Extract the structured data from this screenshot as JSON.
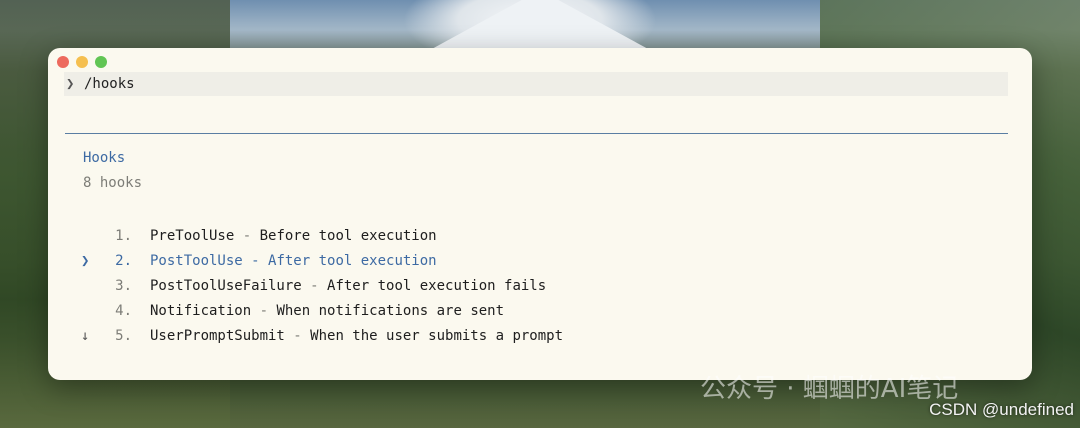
{
  "terminal": {
    "prompt_symbol": "❯",
    "command": "/hooks"
  },
  "hooks_panel": {
    "title": "Hooks",
    "count_label": "8 hooks",
    "items": [
      {
        "marker": "",
        "number": "1.",
        "name": "PreToolUse",
        "separator": " - ",
        "description": "Before tool execution",
        "selected": false
      },
      {
        "marker": "❯",
        "number": "2.",
        "name": "PostToolUse",
        "separator": " - ",
        "description": "After tool execution",
        "selected": true
      },
      {
        "marker": "",
        "number": "3.",
        "name": "PostToolUseFailure",
        "separator": " - ",
        "description": "After tool execution fails",
        "selected": false
      },
      {
        "marker": "",
        "number": "4.",
        "name": "Notification",
        "separator": " - ",
        "description": "When notifications are sent",
        "selected": false
      },
      {
        "marker": "↓",
        "number": "5.",
        "name": "UserPromptSubmit",
        "separator": " - ",
        "description": "When the user submits a prompt",
        "selected": false
      }
    ]
  },
  "watermarks": {
    "wechat": "公众号 · 蝈蝈的AI笔记",
    "csdn": "CSDN @undefined"
  },
  "colors": {
    "accent": "#3d6aa3",
    "window_bg": "#fbf9ef",
    "close": "#ed6a5e",
    "minimize": "#f5bf4f",
    "maximize": "#61c554"
  }
}
